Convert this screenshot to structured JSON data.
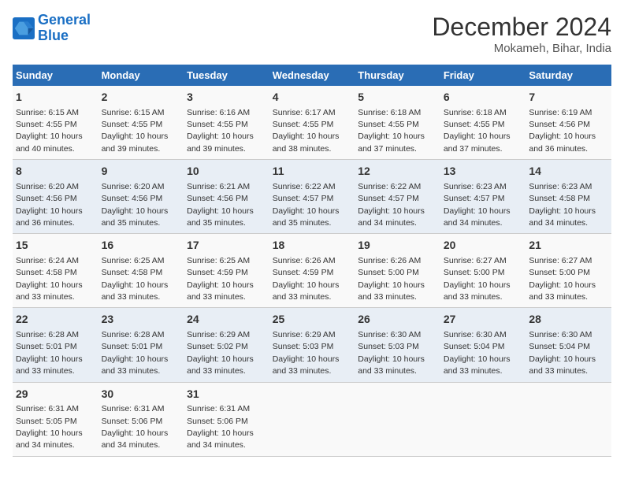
{
  "header": {
    "logo_line1": "General",
    "logo_line2": "Blue",
    "month": "December 2024",
    "location": "Mokameh, Bihar, India"
  },
  "days_of_week": [
    "Sunday",
    "Monday",
    "Tuesday",
    "Wednesday",
    "Thursday",
    "Friday",
    "Saturday"
  ],
  "weeks": [
    [
      {
        "day": 1,
        "sunrise": "6:15 AM",
        "sunset": "4:55 PM",
        "daylight": "10 hours and 40 minutes."
      },
      {
        "day": 2,
        "sunrise": "6:15 AM",
        "sunset": "4:55 PM",
        "daylight": "10 hours and 39 minutes."
      },
      {
        "day": 3,
        "sunrise": "6:16 AM",
        "sunset": "4:55 PM",
        "daylight": "10 hours and 39 minutes."
      },
      {
        "day": 4,
        "sunrise": "6:17 AM",
        "sunset": "4:55 PM",
        "daylight": "10 hours and 38 minutes."
      },
      {
        "day": 5,
        "sunrise": "6:18 AM",
        "sunset": "4:55 PM",
        "daylight": "10 hours and 37 minutes."
      },
      {
        "day": 6,
        "sunrise": "6:18 AM",
        "sunset": "4:55 PM",
        "daylight": "10 hours and 37 minutes."
      },
      {
        "day": 7,
        "sunrise": "6:19 AM",
        "sunset": "4:56 PM",
        "daylight": "10 hours and 36 minutes."
      }
    ],
    [
      {
        "day": 8,
        "sunrise": "6:20 AM",
        "sunset": "4:56 PM",
        "daylight": "10 hours and 36 minutes."
      },
      {
        "day": 9,
        "sunrise": "6:20 AM",
        "sunset": "4:56 PM",
        "daylight": "10 hours and 35 minutes."
      },
      {
        "day": 10,
        "sunrise": "6:21 AM",
        "sunset": "4:56 PM",
        "daylight": "10 hours and 35 minutes."
      },
      {
        "day": 11,
        "sunrise": "6:22 AM",
        "sunset": "4:57 PM",
        "daylight": "10 hours and 35 minutes."
      },
      {
        "day": 12,
        "sunrise": "6:22 AM",
        "sunset": "4:57 PM",
        "daylight": "10 hours and 34 minutes."
      },
      {
        "day": 13,
        "sunrise": "6:23 AM",
        "sunset": "4:57 PM",
        "daylight": "10 hours and 34 minutes."
      },
      {
        "day": 14,
        "sunrise": "6:23 AM",
        "sunset": "4:58 PM",
        "daylight": "10 hours and 34 minutes."
      }
    ],
    [
      {
        "day": 15,
        "sunrise": "6:24 AM",
        "sunset": "4:58 PM",
        "daylight": "10 hours and 33 minutes."
      },
      {
        "day": 16,
        "sunrise": "6:25 AM",
        "sunset": "4:58 PM",
        "daylight": "10 hours and 33 minutes."
      },
      {
        "day": 17,
        "sunrise": "6:25 AM",
        "sunset": "4:59 PM",
        "daylight": "10 hours and 33 minutes."
      },
      {
        "day": 18,
        "sunrise": "6:26 AM",
        "sunset": "4:59 PM",
        "daylight": "10 hours and 33 minutes."
      },
      {
        "day": 19,
        "sunrise": "6:26 AM",
        "sunset": "5:00 PM",
        "daylight": "10 hours and 33 minutes."
      },
      {
        "day": 20,
        "sunrise": "6:27 AM",
        "sunset": "5:00 PM",
        "daylight": "10 hours and 33 minutes."
      },
      {
        "day": 21,
        "sunrise": "6:27 AM",
        "sunset": "5:00 PM",
        "daylight": "10 hours and 33 minutes."
      }
    ],
    [
      {
        "day": 22,
        "sunrise": "6:28 AM",
        "sunset": "5:01 PM",
        "daylight": "10 hours and 33 minutes."
      },
      {
        "day": 23,
        "sunrise": "6:28 AM",
        "sunset": "5:01 PM",
        "daylight": "10 hours and 33 minutes."
      },
      {
        "day": 24,
        "sunrise": "6:29 AM",
        "sunset": "5:02 PM",
        "daylight": "10 hours and 33 minutes."
      },
      {
        "day": 25,
        "sunrise": "6:29 AM",
        "sunset": "5:03 PM",
        "daylight": "10 hours and 33 minutes."
      },
      {
        "day": 26,
        "sunrise": "6:30 AM",
        "sunset": "5:03 PM",
        "daylight": "10 hours and 33 minutes."
      },
      {
        "day": 27,
        "sunrise": "6:30 AM",
        "sunset": "5:04 PM",
        "daylight": "10 hours and 33 minutes."
      },
      {
        "day": 28,
        "sunrise": "6:30 AM",
        "sunset": "5:04 PM",
        "daylight": "10 hours and 33 minutes."
      }
    ],
    [
      {
        "day": 29,
        "sunrise": "6:31 AM",
        "sunset": "5:05 PM",
        "daylight": "10 hours and 34 minutes."
      },
      {
        "day": 30,
        "sunrise": "6:31 AM",
        "sunset": "5:06 PM",
        "daylight": "10 hours and 34 minutes."
      },
      {
        "day": 31,
        "sunrise": "6:31 AM",
        "sunset": "5:06 PM",
        "daylight": "10 hours and 34 minutes."
      },
      null,
      null,
      null,
      null
    ]
  ],
  "labels": {
    "sunrise": "Sunrise:",
    "sunset": "Sunset:",
    "daylight": "Daylight:"
  }
}
